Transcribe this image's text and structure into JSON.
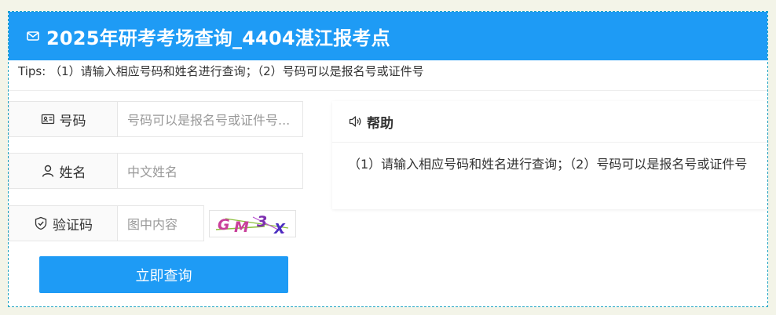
{
  "header": {
    "icon": "envelope-icon",
    "title": "2025年研考考场查询_4404湛江报考点"
  },
  "tips": {
    "text": "Tips: （1）请输入相应号码和姓名进行查询；（2）号码可以是报名号或证件号"
  },
  "form": {
    "id_number": {
      "icon": "id-card-icon",
      "label": "号码",
      "placeholder": "号码可以是报名号或证件号..."
    },
    "name": {
      "icon": "user-icon",
      "label": "姓名",
      "placeholder": "中文姓名"
    },
    "captcha": {
      "icon": "shield-check-icon",
      "label": "验证码",
      "placeholder": "图中内容",
      "image_text": "GM3X"
    },
    "submit_label": "立即查询"
  },
  "help": {
    "icon": "speaker-icon",
    "title": "帮助",
    "body": "（1）请输入相应号码和姓名进行查询；（2）号码可以是报名号或证件号"
  },
  "colors": {
    "primary": "#1e9bf5",
    "page_background": "#f3f4e8",
    "frame_border": "#1fa4c3"
  }
}
